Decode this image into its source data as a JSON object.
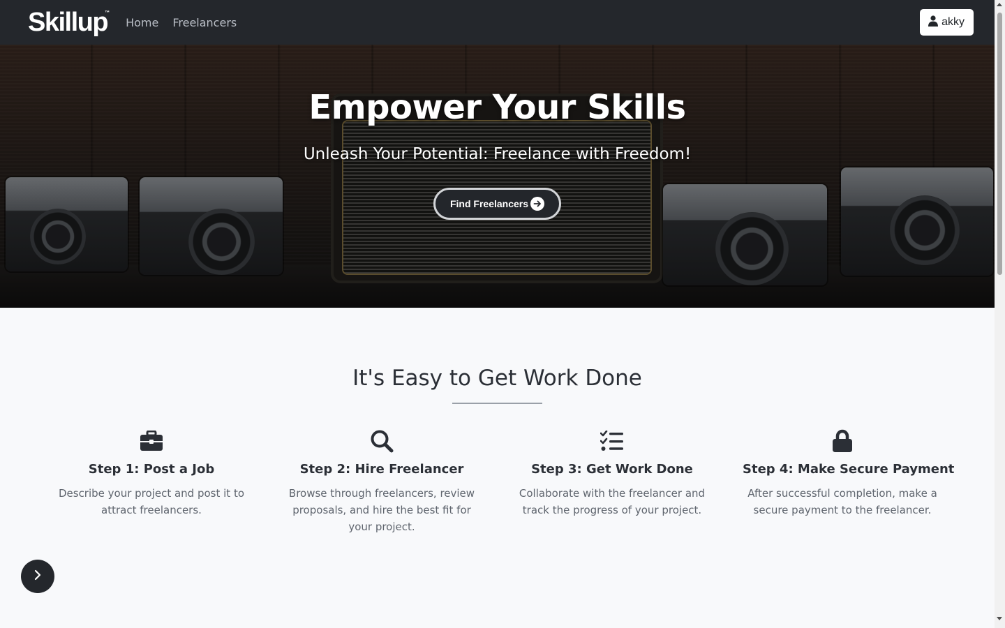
{
  "navbar": {
    "brand": "Skillup",
    "brand_mark": "™",
    "links": [
      {
        "label": "Home"
      },
      {
        "label": "Freelancers"
      }
    ],
    "user": {
      "name": "akky",
      "icon": "user-icon"
    }
  },
  "hero": {
    "title": "Empower Your Skills",
    "subtitle": "Unleash Your Potential: Freelance with Freedom!",
    "cta_label": "Find Freelancers",
    "cta_icon": "arrow-right-circle-icon"
  },
  "how_it_works": {
    "title": "It's Easy to Get Work Done",
    "steps": [
      {
        "icon": "briefcase-icon",
        "title": "Step 1: Post a Job",
        "text": "Describe your project and post it to attract freelancers."
      },
      {
        "icon": "search-icon",
        "title": "Step 2: Hire Freelancer",
        "text": "Browse through freelancers, review proposals, and hire the best fit for your project."
      },
      {
        "icon": "task-list-icon",
        "title": "Step 3: Get Work Done",
        "text": "Collaborate with the freelancer and track the progress of your project."
      },
      {
        "icon": "lock-icon",
        "title": "Step 4: Make Secure Payment",
        "text": "After successful completion, make a secure payment to the freelancer."
      }
    ]
  },
  "floating_button": {
    "icon": "chevron-right-icon"
  },
  "colors": {
    "navbar_bg": "#24272c",
    "page_bg": "#f8f9fb",
    "text_dark": "#2b2f36",
    "text_muted": "#5f656e"
  }
}
